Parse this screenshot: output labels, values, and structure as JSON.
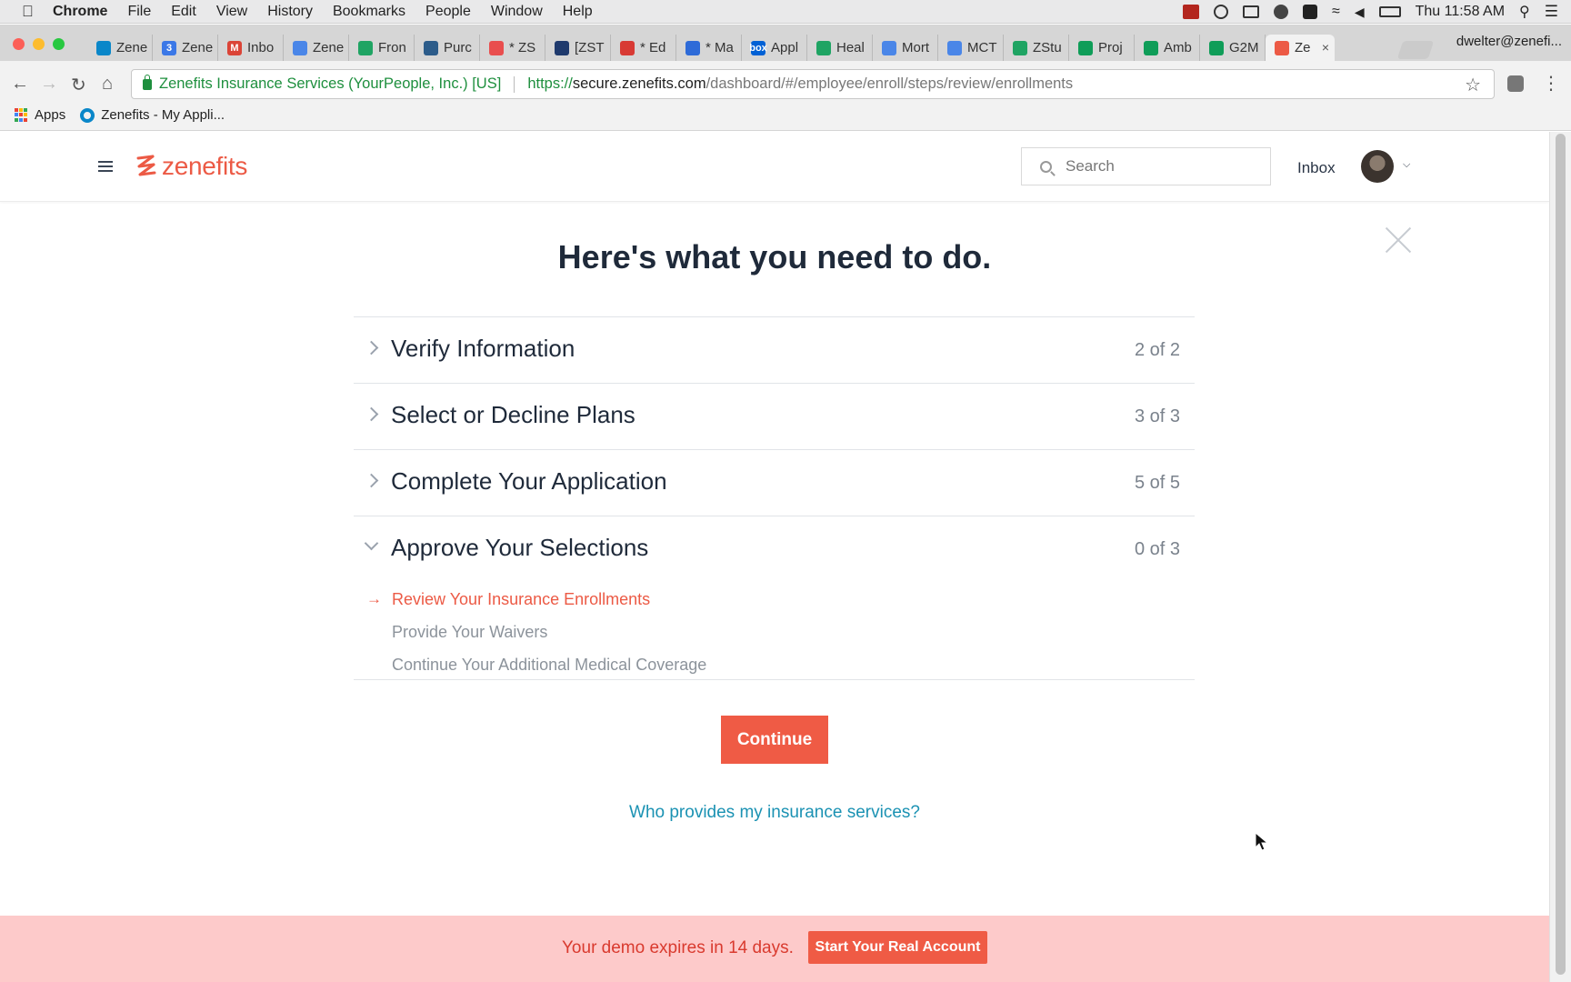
{
  "menubar": {
    "app": "Chrome",
    "items": [
      "File",
      "Edit",
      "View",
      "History",
      "Bookmarks",
      "People",
      "Window",
      "Help"
    ],
    "clock": "Thu 11:58 AM"
  },
  "tabs": [
    {
      "label": "Zene",
      "fav_color": "#0a87c9",
      "fav_text": ""
    },
    {
      "label": "Zene",
      "fav_color": "#3b78e7",
      "fav_text": "3"
    },
    {
      "label": "Inbo",
      "fav_color": "#db4437",
      "fav_text": "M"
    },
    {
      "label": "Zene",
      "fav_color": "#4a86e8",
      "fav_text": ""
    },
    {
      "label": "Fron",
      "fav_color": "#1fa463",
      "fav_text": ""
    },
    {
      "label": "Purc",
      "fav_color": "#2c5c8a",
      "fav_text": ""
    },
    {
      "label": "* ZS",
      "fav_color": "#e94e4e",
      "fav_text": ""
    },
    {
      "label": "[ZST",
      "fav_color": "#1f3a6d",
      "fav_text": ""
    },
    {
      "label": "* Ed",
      "fav_color": "#d83a34",
      "fav_text": ""
    },
    {
      "label": "* Ma",
      "fav_color": "#2e6bd8",
      "fav_text": ""
    },
    {
      "label": "Appl",
      "fav_color": "#0061d5",
      "fav_text": "box"
    },
    {
      "label": "Heal",
      "fav_color": "#1fa463",
      "fav_text": ""
    },
    {
      "label": "Mort",
      "fav_color": "#4a86e8",
      "fav_text": ""
    },
    {
      "label": "MCT",
      "fav_color": "#4a86e8",
      "fav_text": ""
    },
    {
      "label": "ZStu",
      "fav_color": "#1fa463",
      "fav_text": ""
    },
    {
      "label": "Proj",
      "fav_color": "#0f9d58",
      "fav_text": ""
    },
    {
      "label": "Amb",
      "fav_color": "#0f9d58",
      "fav_text": ""
    },
    {
      "label": "G2M",
      "fav_color": "#0f9d58",
      "fav_text": ""
    },
    {
      "label": "Ze",
      "fav_color": "#ec5a45",
      "fav_text": "",
      "active": true
    }
  ],
  "profile_name": "dwelter@zenefi...",
  "omnibox": {
    "site_name": "Zenefits Insurance Services (YourPeople, Inc.) [US]",
    "scheme": "https://",
    "host": "secure.zenefits.com",
    "path": "/dashboard/#/employee/enroll/steps/review/enrollments"
  },
  "bookmarks": [
    "Apps",
    "Zenefits - My Appli..."
  ],
  "app": {
    "logo_text": "zenefits",
    "brand_color": "#ec5a45",
    "search_placeholder": "Search",
    "inbox_label": "Inbox"
  },
  "main": {
    "heading": "Here's what you need to do.",
    "steps": [
      {
        "title": "Verify Information",
        "count": "2 of 2"
      },
      {
        "title": "Select or Decline Plans",
        "count": "3 of 3"
      },
      {
        "title": "Complete Your Application",
        "count": "5 of 5"
      },
      {
        "title": "Approve Your Selections",
        "count": "0 of 3",
        "substeps": [
          "Review Your Insurance Enrollments",
          "Provide Your Waivers",
          "Continue Your Additional Medical Coverage"
        ]
      }
    ],
    "continue_label": "Continue",
    "help_link": "Who provides my insurance services?"
  },
  "demo_banner": {
    "message": "Your demo expires in 14 days.",
    "cta": "Start Your Real Account"
  }
}
